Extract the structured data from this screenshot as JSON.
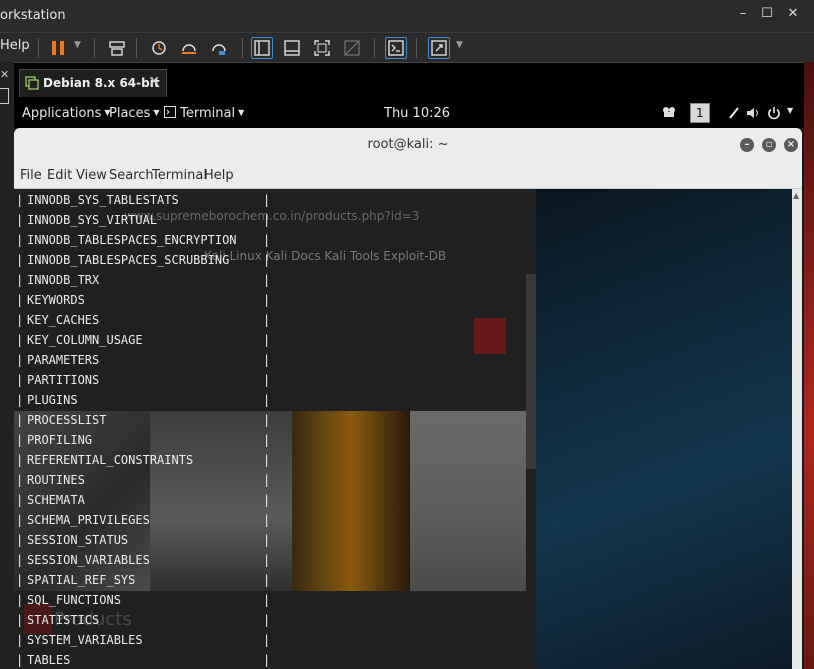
{
  "host": {
    "title": "orkstation",
    "help": "Help",
    "min": "–",
    "max": "☐",
    "close": "✕"
  },
  "vm_tab": {
    "label": "Debian 8.x 64-bit",
    "close": "✕"
  },
  "gnome": {
    "applications": "Applications",
    "places": "Places",
    "terminal": "Terminal",
    "clock": "Thu 10:26",
    "workspace": "1"
  },
  "terminal": {
    "title": "root@kali: ~",
    "menu": [
      "File",
      "Edit",
      "View",
      "Search",
      "Terminal",
      "Help"
    ],
    "lines": [
      "INNODB_SYS_TABLESTATS",
      "INNODB_SYS_VIRTUAL",
      "INNODB_TABLESPACES_ENCRYPTION",
      "INNODB_TABLESPACES_SCRUBBING",
      "INNODB_TRX",
      "KEYWORDS",
      "KEY_CACHES",
      "KEY_COLUMN_USAGE",
      "PARAMETERS",
      "PARTITIONS",
      "PLUGINS",
      "PROCESSLIST",
      "PROFILING",
      "REFERENTIAL_CONSTRAINTS",
      "ROUTINES",
      "SCHEMATA",
      "SCHEMA_PRIVILEGES",
      "SESSION_STATUS",
      "SESSION_VARIABLES",
      "SPATIAL_REF_SYS",
      "SQL_FUNCTIONS",
      "STATISTICS",
      "SYSTEM_VARIABLES",
      "TABLES"
    ]
  },
  "ghost_browser": {
    "url": "www.supremeborochem.co.in/products.php?id=3",
    "bookmarks": "Kali Linux   Kali Docs   Kali Tools   Exploit-DB",
    "products": "Products"
  },
  "colors": {
    "accent": "#3d8fd6",
    "pause": "#f07a1a"
  }
}
